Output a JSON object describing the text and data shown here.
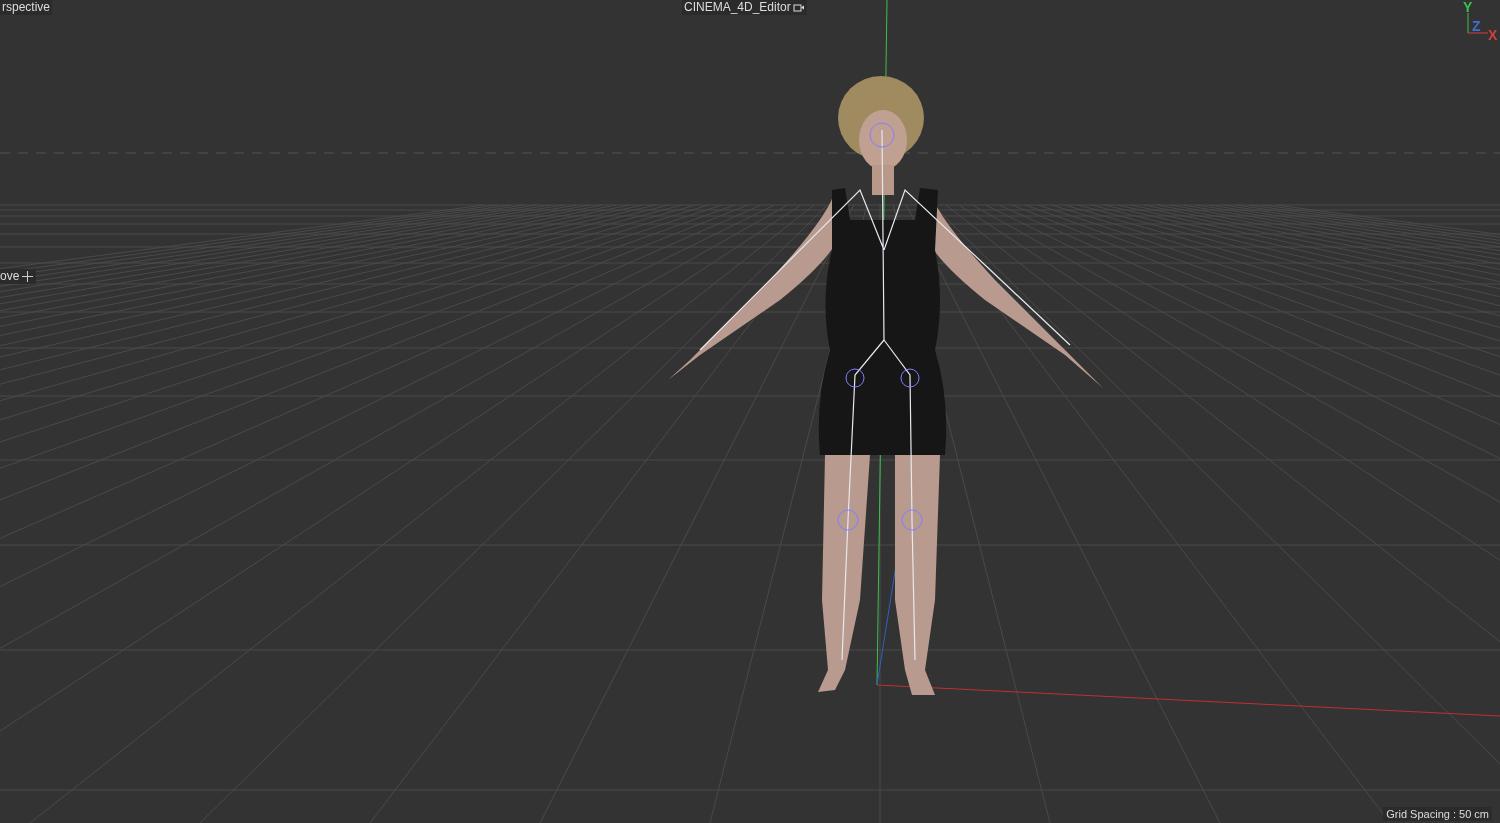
{
  "viewport": {
    "camera_label": "rspective",
    "title": "CINEMA_4D_Editor",
    "tool_label": "ove",
    "grid_spacing": "Grid Spacing : 50 cm",
    "axes": [
      {
        "letter": "Y",
        "color": "#3fbf4f"
      },
      {
        "letter": "Z",
        "color": "#3f6fd0"
      },
      {
        "letter": "X",
        "color": "#d04040"
      }
    ]
  }
}
